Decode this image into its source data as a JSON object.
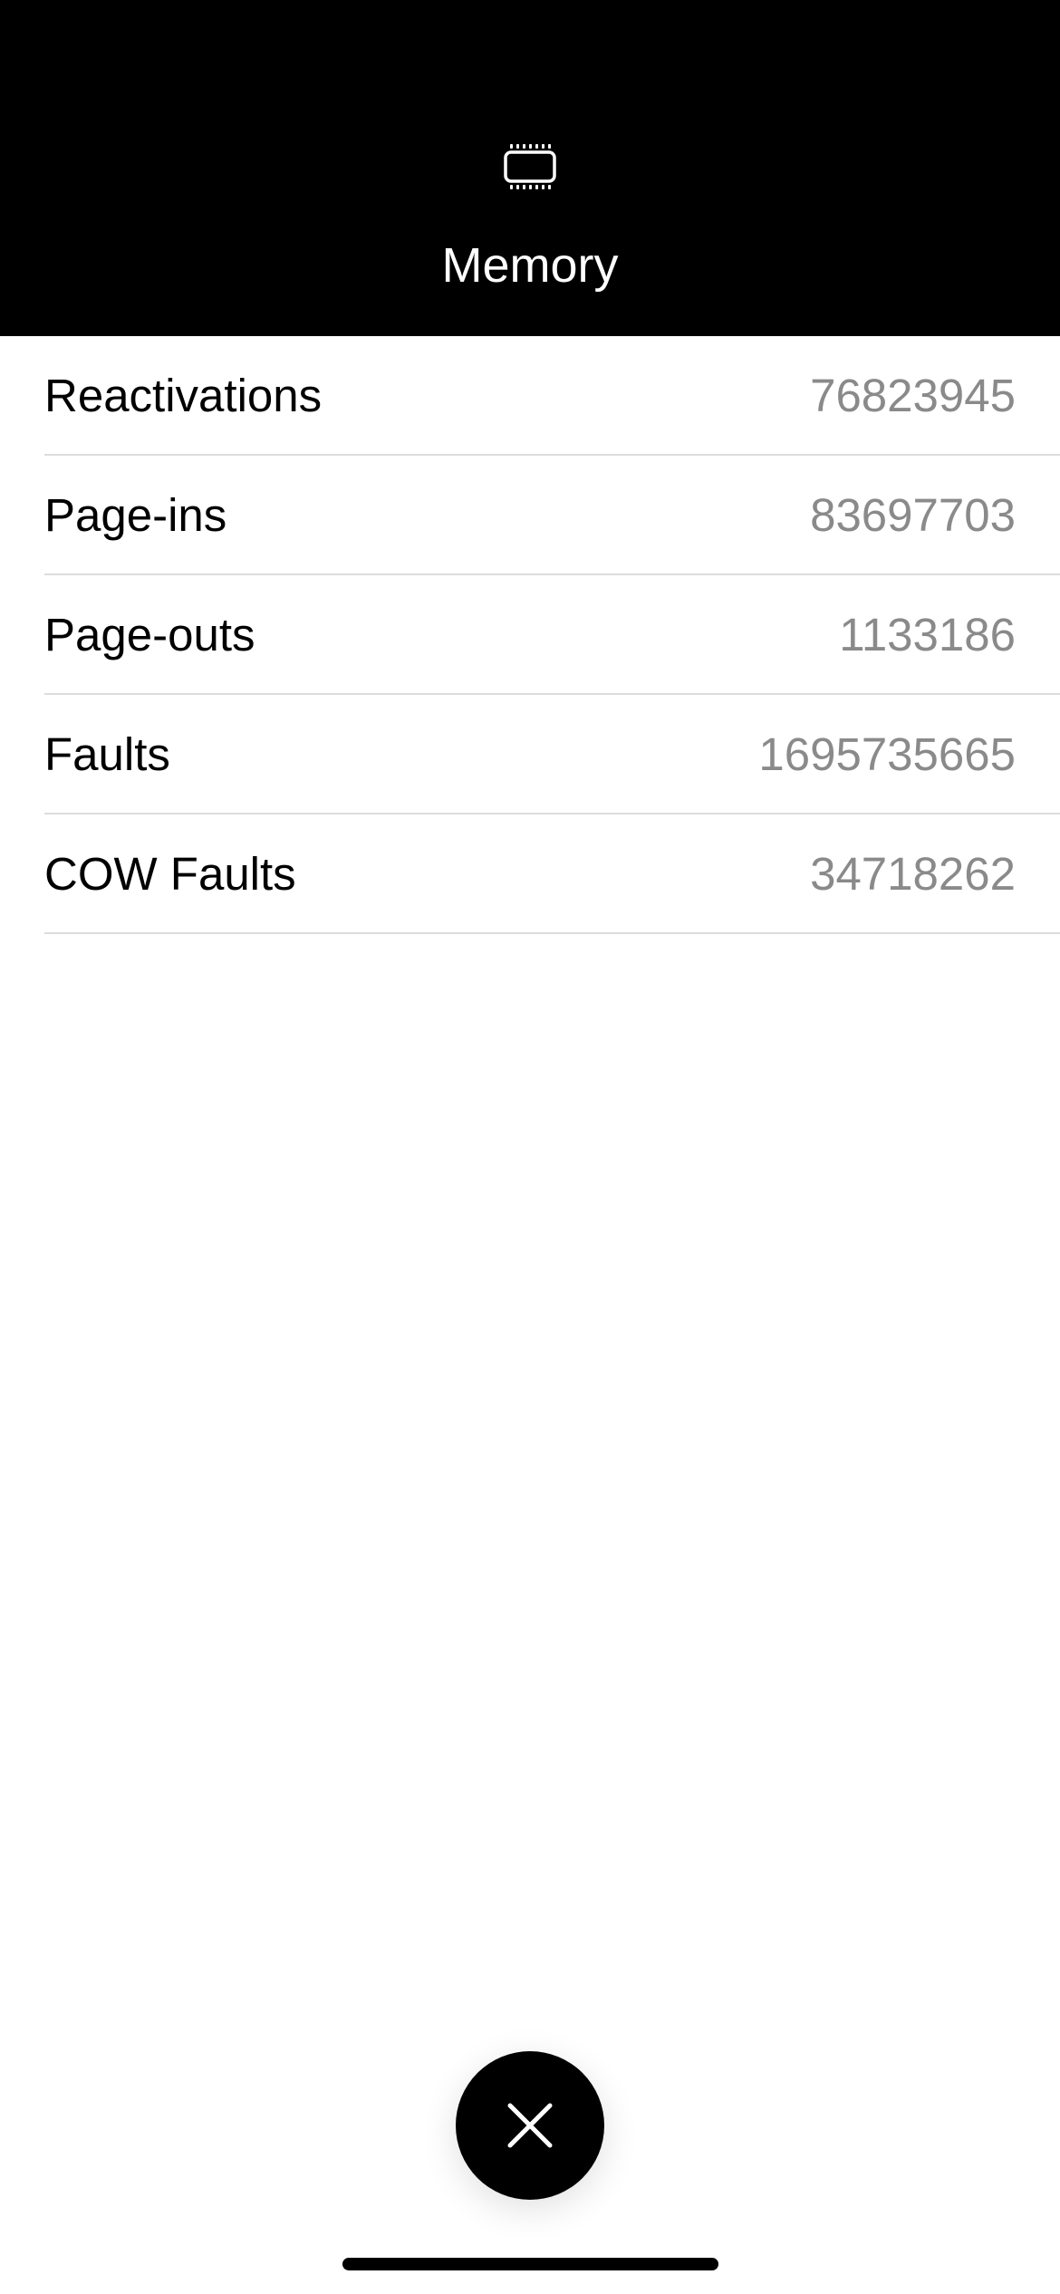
{
  "header": {
    "icon": "memory-chip-icon",
    "title": "Memory"
  },
  "rows": [
    {
      "label": "Reactivations",
      "value": "76823945"
    },
    {
      "label": "Page-ins",
      "value": "83697703"
    },
    {
      "label": "Page-outs",
      "value": "1133186"
    },
    {
      "label": "Faults",
      "value": "1695735665"
    },
    {
      "label": "COW Faults",
      "value": "34718262"
    }
  ],
  "close_button": {
    "icon": "close-icon"
  },
  "colors": {
    "header_background": "#000000",
    "header_text": "#ffffff",
    "label_text": "#000000",
    "value_text": "#8a8a8a",
    "separator": "#dcdcdc"
  }
}
